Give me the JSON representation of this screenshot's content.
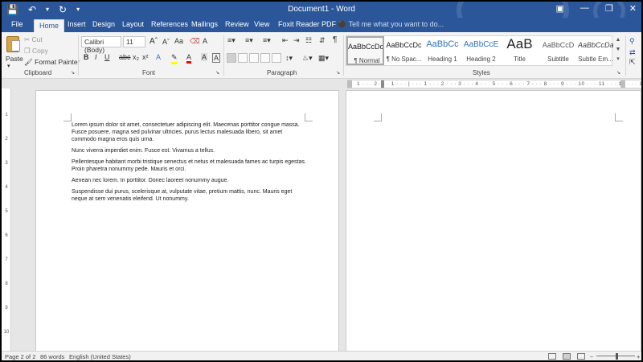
{
  "titlebar": {
    "title": "Document1 - Word"
  },
  "qat": {
    "save_icon": "save-icon",
    "undo_icon": "undo-icon",
    "redo_icon": "redo-icon"
  },
  "tabs": [
    "File",
    "Home",
    "Insert",
    "Design",
    "Layout",
    "References",
    "Mailings",
    "Review",
    "View",
    "Foxit Reader PDF"
  ],
  "tell_me": {
    "placeholder": "Tell me what you want to do..."
  },
  "clipboard": {
    "group_label": "Clipboard",
    "paste": "Paste",
    "cut": "Cut",
    "copy": "Copy",
    "format_painter": "Format Painter"
  },
  "font": {
    "group_label": "Font",
    "family": "Calibri (Body)",
    "size": "11"
  },
  "paragraph": {
    "group_label": "Paragraph"
  },
  "styles": {
    "group_label": "Styles",
    "items": [
      {
        "sample": "AaBbCcDc",
        "label": "¶ Normal"
      },
      {
        "sample": "AaBbCcDc",
        "label": "¶ No Spac..."
      },
      {
        "sample": "AaBbCc",
        "label": "Heading 1"
      },
      {
        "sample": "AaBbCcE",
        "label": "Heading 2"
      },
      {
        "sample": "AaB",
        "label": "Title"
      },
      {
        "sample": "AaBbCcD",
        "label": "Subtitle"
      },
      {
        "sample": "AaBbCcDa",
        "label": "Subtle Em..."
      }
    ]
  },
  "colors": {
    "accent": "#2b579a",
    "highlight": "#ffff00",
    "font_color": "#ff0000"
  },
  "document": {
    "paragraphs": [
      "Lorem ipsum dolor sit amet, consectetuer adipiscing elit. Maecenas porttitor congue massa. Fusce posuere, magna sed pulvinar ultricies, purus lectus malesuada libero, sit amet commodo magna eros quis urna.",
      "Nunc viverra imperdiet enim. Fusce est. Vivamus a tellus.",
      "Pellentesque habitant morbi tristique senectus et netus et malesuada fames ac turpis egestas. Proin pharetra nonummy pede. Mauris et orci.",
      "Aenean nec lorem. In porttitor. Donec laoreet nonummy augue.",
      "Suspendisse dui purus, scelerisque at, vulputate vitae, pretium mattis, nunc. Mauris eget neque at sem venenatis eleifend. Ut nonummy."
    ]
  },
  "status": {
    "page": "Page 2 of 2",
    "words": "86 words",
    "language": "English (United States)"
  }
}
